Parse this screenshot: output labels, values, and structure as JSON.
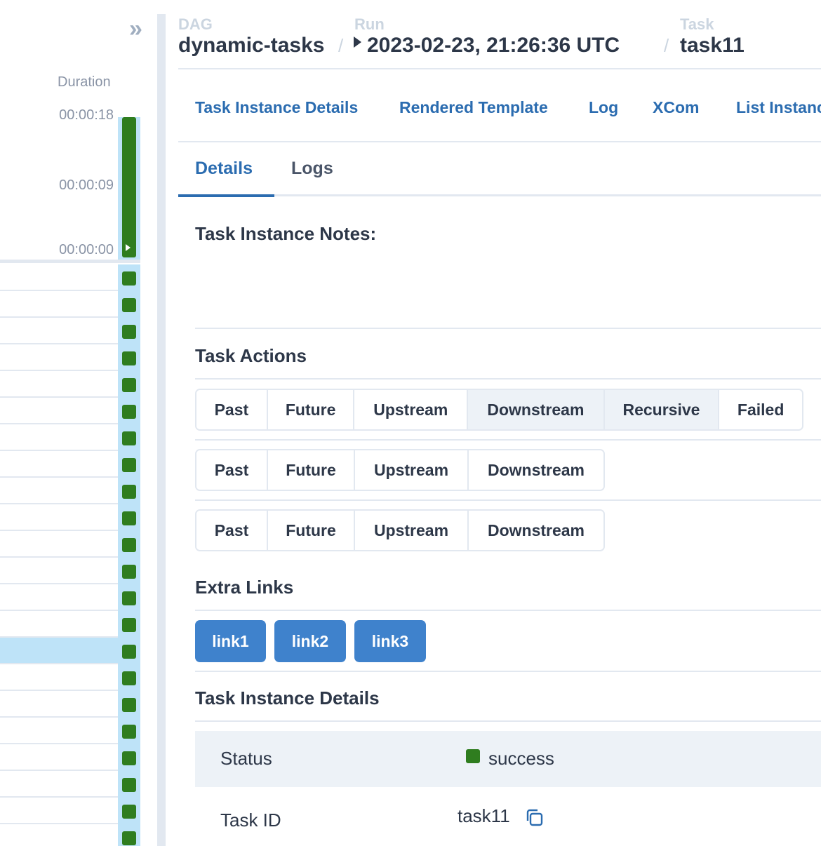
{
  "grid": {
    "duration_label": "Duration",
    "ticks": [
      "00:00:18",
      "00:00:09",
      "00:00:00"
    ],
    "collapse_glyph": "»",
    "row_count": 22,
    "selected_row": 14,
    "row_status_color": "#2f7d1f"
  },
  "breadcrumb": {
    "dag_label": "DAG",
    "dag_value": "dynamic-tasks",
    "run_label": "Run",
    "run_value": "2023-02-23, 21:26:36 UTC",
    "task_label": "Task",
    "task_value": "task11",
    "separator": "/"
  },
  "link_tabs": [
    "Task Instance Details",
    "Rendered Template",
    "Log",
    "XCom",
    "List Instances"
  ],
  "tabs": {
    "details": "Details",
    "logs": "Logs"
  },
  "notes": {
    "title": "Task Instance Notes:"
  },
  "actions": {
    "title": "Task Actions",
    "row1": [
      "Past",
      "Future",
      "Upstream",
      "Downstream",
      "Recursive",
      "Failed"
    ],
    "row1_active": [
      "Downstream",
      "Recursive"
    ],
    "row2": [
      "Past",
      "Future",
      "Upstream",
      "Downstream"
    ],
    "row3": [
      "Past",
      "Future",
      "Upstream",
      "Downstream"
    ]
  },
  "extra_links": {
    "title": "Extra Links",
    "links": [
      "link1",
      "link2",
      "link3"
    ]
  },
  "details": {
    "title": "Task Instance Details",
    "status_key": "Status",
    "status_value": "success",
    "task_id_key": "Task ID",
    "task_id_value": "task11"
  },
  "colors": {
    "accent": "#2b6cb0",
    "success": "#2f7d1f",
    "button": "#3f82cc",
    "selected": "#bee3f8"
  }
}
